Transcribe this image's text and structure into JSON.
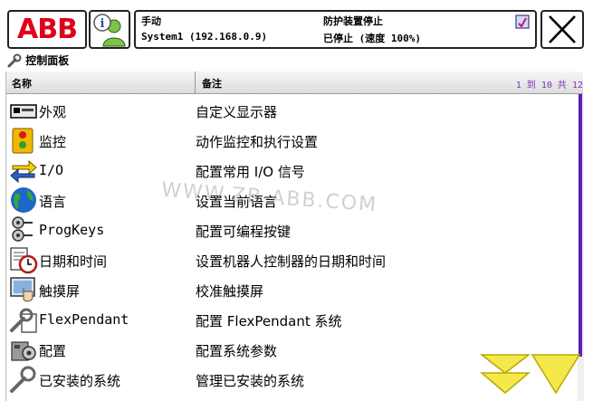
{
  "topbar": {
    "logo_text": "ABB",
    "mode": "手动",
    "system": "System1 (192.168.0.9)",
    "guard": "防护装置停止",
    "state": "已停止 (速度 100%)"
  },
  "panel": {
    "title": "控制面板"
  },
  "table": {
    "col_name": "名称",
    "col_note": "备注",
    "paging": "1 到 10 共 12",
    "rows": [
      {
        "name": "外观",
        "note": "自定义显示器",
        "icon": "appearance-icon"
      },
      {
        "name": "监控",
        "note": "动作监控和执行设置",
        "icon": "supervision-icon"
      },
      {
        "name": "I/O",
        "note": "配置常用 I/O 信号",
        "icon": "io-icon"
      },
      {
        "name": "语言",
        "note": "设置当前语言",
        "icon": "globe-icon"
      },
      {
        "name": "ProgKeys",
        "note": "配置可编程按键",
        "icon": "progkeys-icon"
      },
      {
        "name": "日期和时间",
        "note": "设置机器人控制器的日期和时间",
        "icon": "clock-icon"
      },
      {
        "name": "触摸屏",
        "note": "校准触摸屏",
        "icon": "touchscreen-icon"
      },
      {
        "name": "FlexPendant",
        "note": "配置 FlexPendant 系统",
        "icon": "flexpendant-icon"
      },
      {
        "name": "配置",
        "note": "配置系统参数",
        "icon": "configuration-icon"
      },
      {
        "name": "已安装的系统",
        "note": "管理已安装的系统",
        "icon": "installed-systems-icon"
      }
    ]
  },
  "watermark": "WWW.ZB-ABB.COM",
  "colors": {
    "abb_red": "#e0001a",
    "scroll": "#5b20c0",
    "paging_text": "#7b36b8",
    "arrow_yellow": "#f5e84a"
  }
}
